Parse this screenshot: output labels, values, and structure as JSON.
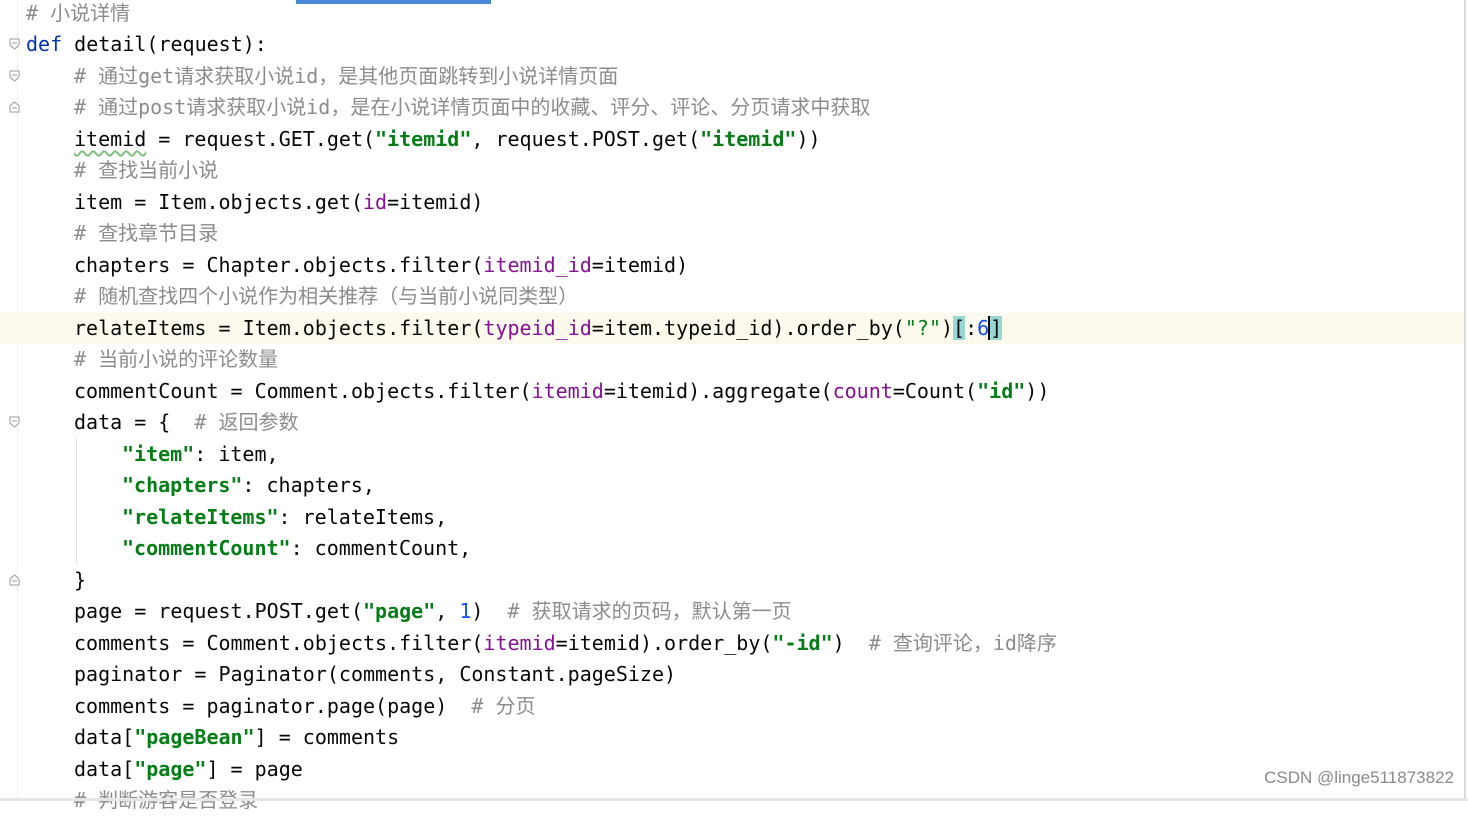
{
  "editor": {
    "current_line_index": 10,
    "lines": [
      {
        "tokens": [
          {
            "c": "cmt",
            "t": "# 小说详情"
          }
        ]
      },
      {
        "tokens": [
          {
            "c": "kw",
            "t": "def"
          },
          {
            "c": "",
            "t": " detail(request):"
          }
        ]
      },
      {
        "tokens": [
          {
            "c": "cmt",
            "t": "# 通过get请求获取小说id，是其他页面跳转到小说详情页面"
          }
        ]
      },
      {
        "tokens": [
          {
            "c": "cmt",
            "t": "# 通过post请求获取小说id，是在小说详情页面中的收藏、评分、评论、分页请求中获取"
          }
        ]
      },
      {
        "tokens": [
          {
            "c": "squiggle",
            "t": "itemid"
          },
          {
            "c": "",
            "t": " = request.GET.get("
          },
          {
            "c": "str",
            "t": "\"itemid\""
          },
          {
            "c": "",
            "t": ", request.POST.get("
          },
          {
            "c": "str",
            "t": "\"itemid\""
          },
          {
            "c": "",
            "t": "))"
          }
        ]
      },
      {
        "tokens": [
          {
            "c": "cmt",
            "t": "# 查找当前小说"
          }
        ]
      },
      {
        "tokens": [
          {
            "c": "",
            "t": "item = Item.objects.get("
          },
          {
            "c": "prm",
            "t": "id"
          },
          {
            "c": "",
            "t": "=itemid)"
          }
        ]
      },
      {
        "tokens": [
          {
            "c": "cmt",
            "t": "# 查找章节目录"
          }
        ]
      },
      {
        "tokens": [
          {
            "c": "",
            "t": "chapters = Chapter.objects.filter("
          },
          {
            "c": "prm",
            "t": "itemid_id"
          },
          {
            "c": "",
            "t": "=itemid)"
          }
        ]
      },
      {
        "tokens": [
          {
            "c": "cmt",
            "t": "# 随机查找四个小说作为相关推荐（与当前小说同类型）"
          }
        ]
      },
      {
        "tokens": [
          {
            "c": "",
            "t": "relateItems = Item.objects.filter("
          },
          {
            "c": "prm",
            "t": "typeid_id"
          },
          {
            "c": "",
            "t": "=item.typeid_id).order_by("
          },
          {
            "c": "str-plain",
            "t": "\"?\""
          },
          {
            "c": "",
            "t": ")"
          },
          {
            "c": "brk",
            "t": "["
          },
          {
            "c": "",
            "t": ":"
          },
          {
            "c": "num",
            "t": "6"
          },
          {
            "c": "caret",
            "t": ""
          },
          {
            "c": "brk",
            "t": "]"
          }
        ]
      },
      {
        "tokens": [
          {
            "c": "cmt",
            "t": "# 当前小说的评论数量"
          }
        ]
      },
      {
        "tokens": [
          {
            "c": "",
            "t": "commentCount = Comment.objects.filter("
          },
          {
            "c": "prm",
            "t": "itemid"
          },
          {
            "c": "",
            "t": "=itemid).aggregate("
          },
          {
            "c": "prm",
            "t": "count"
          },
          {
            "c": "",
            "t": "=Count("
          },
          {
            "c": "str",
            "t": "\"id\""
          },
          {
            "c": "",
            "t": "))"
          }
        ]
      },
      {
        "tokens": [
          {
            "c": "",
            "t": "data = {  "
          },
          {
            "c": "cmt",
            "t": "# 返回参数"
          }
        ]
      },
      {
        "tokens": [
          {
            "c": "str",
            "t": "\"item\""
          },
          {
            "c": "",
            "t": ": item,"
          }
        ]
      },
      {
        "tokens": [
          {
            "c": "str",
            "t": "\"chapters\""
          },
          {
            "c": "",
            "t": ": chapters,"
          }
        ]
      },
      {
        "tokens": [
          {
            "c": "str",
            "t": "\"relateItems\""
          },
          {
            "c": "",
            "t": ": relateItems,"
          }
        ]
      },
      {
        "tokens": [
          {
            "c": "str",
            "t": "\"commentCount\""
          },
          {
            "c": "",
            "t": ": commentCount,"
          }
        ]
      },
      {
        "tokens": [
          {
            "c": "",
            "t": "}"
          }
        ]
      },
      {
        "tokens": [
          {
            "c": "",
            "t": "page = request.POST.get("
          },
          {
            "c": "str",
            "t": "\"page\""
          },
          {
            "c": "",
            "t": ", "
          },
          {
            "c": "num",
            "t": "1"
          },
          {
            "c": "",
            "t": ")  "
          },
          {
            "c": "cmt",
            "t": "# 获取请求的页码，默认第一页"
          }
        ]
      },
      {
        "tokens": [
          {
            "c": "",
            "t": "comments = Comment.objects.filter("
          },
          {
            "c": "prm",
            "t": "itemid"
          },
          {
            "c": "",
            "t": "=itemid).order_by("
          },
          {
            "c": "str",
            "t": "\"-id\""
          },
          {
            "c": "",
            "t": ")  "
          },
          {
            "c": "cmt",
            "t": "# 查询评论，id降序"
          }
        ]
      },
      {
        "tokens": [
          {
            "c": "",
            "t": "paginator = Paginator(comments, Constant.pageSize)"
          }
        ]
      },
      {
        "tokens": [
          {
            "c": "",
            "t": "comments = paginator.page(page)  "
          },
          {
            "c": "cmt",
            "t": "# 分页"
          }
        ]
      },
      {
        "tokens": [
          {
            "c": "",
            "t": "data["
          },
          {
            "c": "str",
            "t": "\"pageBean\""
          },
          {
            "c": "",
            "t": "] = comments"
          }
        ]
      },
      {
        "tokens": [
          {
            "c": "",
            "t": "data["
          },
          {
            "c": "str",
            "t": "\"page\""
          },
          {
            "c": "",
            "t": "] = page"
          }
        ]
      },
      {
        "tokens": [
          {
            "c": "cmt",
            "t": "# 判断游客是否登录"
          }
        ]
      }
    ]
  },
  "watermark": "CSDN @linge511873822"
}
